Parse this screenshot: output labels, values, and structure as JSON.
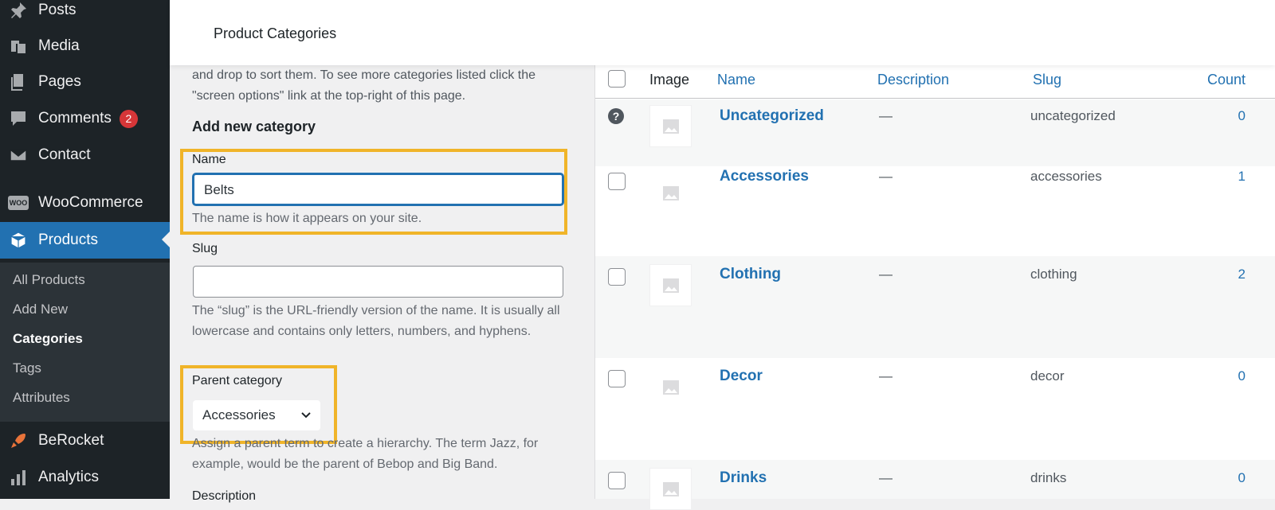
{
  "sidebar": {
    "menu": [
      {
        "label": "Posts",
        "icon": "pin-icon"
      },
      {
        "label": "Media",
        "icon": "media-icon"
      },
      {
        "label": "Pages",
        "icon": "pages-icon"
      },
      {
        "label": "Comments",
        "icon": "comments-icon",
        "badge": "2"
      },
      {
        "label": "Contact",
        "icon": "mail-icon"
      },
      {
        "label": "WooCommerce",
        "icon": "woo-icon",
        "icon_text": "WOO"
      },
      {
        "label": "Products",
        "icon": "box-icon",
        "active": true
      },
      {
        "label": "BeRocket",
        "icon": "rocket-icon"
      },
      {
        "label": "Analytics",
        "icon": "bar-chart-icon"
      }
    ],
    "submenu": [
      "All Products",
      "Add New",
      "Categories",
      "Tags",
      "Attributes"
    ],
    "current_submenu": "Categories"
  },
  "header": {
    "title": "Product Categories"
  },
  "form": {
    "intro": "and drop to sort them. To see more categories listed click the \"screen options\" link at the top-right of this page.",
    "section_title": "Add new category",
    "name_label": "Name",
    "name_value": "Belts",
    "name_help": "The name is how it appears on your site.",
    "slug_label": "Slug",
    "slug_value": "",
    "slug_help": "The “slug” is the URL-friendly version of the name. It is usually all lowercase and contains only letters, numbers, and hyphens.",
    "parent_label": "Parent category",
    "parent_value": "Accessories",
    "parent_help": "Assign a parent term to create a hierarchy. The term Jazz, for example, would be the parent of Bebop and Big Band.",
    "description_label": "Description"
  },
  "table": {
    "columns": {
      "image": "Image",
      "name": "Name",
      "description": "Description",
      "slug": "Slug",
      "count": "Count"
    },
    "rows": [
      {
        "name": "Uncategorized",
        "description": "—",
        "slug": "uncategorized",
        "count": "0",
        "help_icon": "?"
      },
      {
        "name": "Accessories",
        "description": "—",
        "slug": "accessories",
        "count": "1"
      },
      {
        "name": "Clothing",
        "description": "—",
        "slug": "clothing",
        "count": "2"
      },
      {
        "name": "Decor",
        "description": "—",
        "slug": "decor",
        "count": "0"
      },
      {
        "name": "Drinks",
        "description": "—",
        "slug": "drinks",
        "count": "0"
      }
    ]
  },
  "colors": {
    "highlight": "#f0b429",
    "accent": "#2271b1",
    "sidebar": "#1d2327",
    "badge": "#d63638"
  }
}
